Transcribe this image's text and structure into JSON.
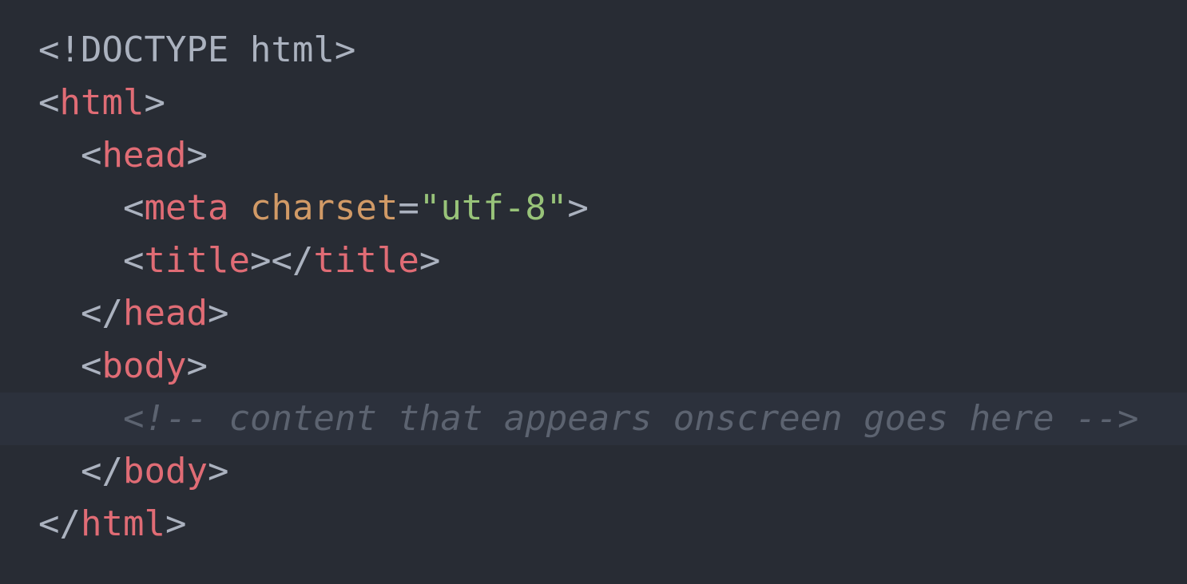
{
  "code": {
    "line1": {
      "doctype": "<!DOCTYPE html>"
    },
    "line2": {
      "open": "<",
      "tag": "html",
      "close": ">"
    },
    "line3": {
      "open": "<",
      "tag": "head",
      "close": ">"
    },
    "line4": {
      "open": "<",
      "tag": "meta",
      "space": " ",
      "attr": "charset",
      "eq": "=",
      "value": "\"utf-8\"",
      "close": ">"
    },
    "line5": {
      "open": "<",
      "tag": "title",
      "mid": "></",
      "tag2": "title",
      "close": ">"
    },
    "line6": {
      "open": "</",
      "tag": "head",
      "close": ">"
    },
    "line7": {
      "open": "<",
      "tag": "body",
      "close": ">"
    },
    "line8": {
      "comment": "<!-- content that appears onscreen goes here -->"
    },
    "line9": {
      "open": "</",
      "tag": "body",
      "close": ">"
    },
    "line10": {
      "open": "</",
      "tag": "html",
      "close": ">"
    }
  },
  "colors": {
    "background": "#282c34",
    "current_line": "#2c313c",
    "punctuation": "#abb2bf",
    "tag": "#e06c75",
    "attribute": "#d19a66",
    "string": "#98c379",
    "comment": "#5c6370"
  }
}
